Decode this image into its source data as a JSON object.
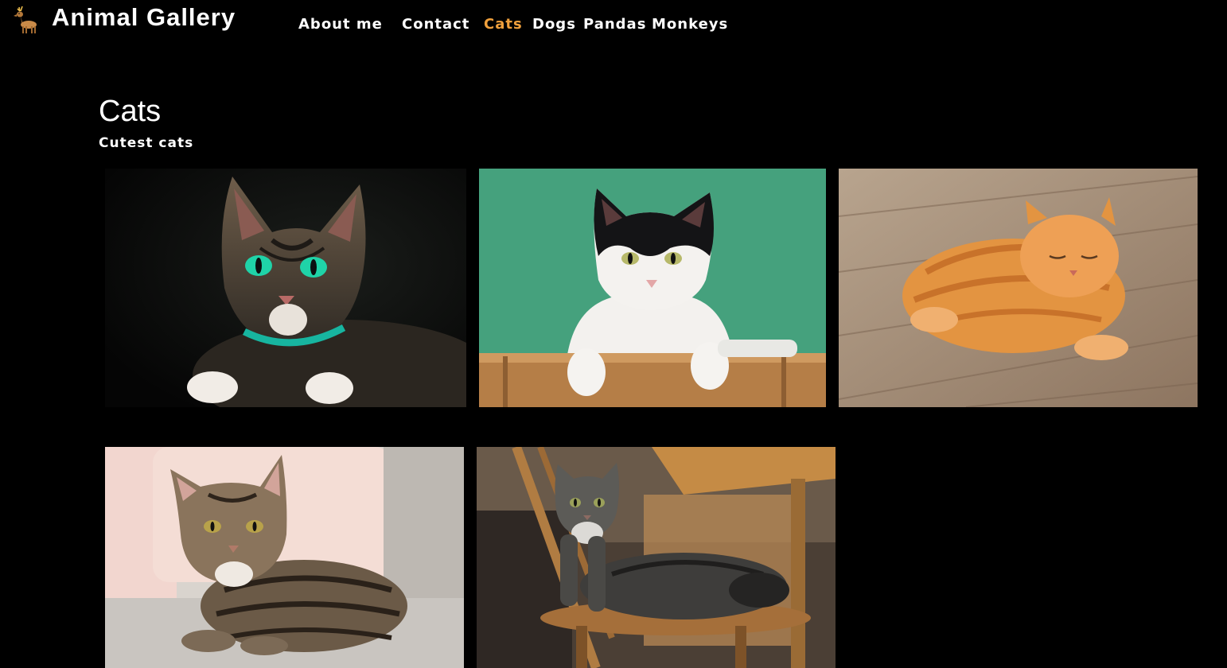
{
  "header": {
    "logo_icon": "deer-icon",
    "site_title": "Animal Gallery"
  },
  "nav": {
    "items": [
      {
        "label": "About me",
        "active": false
      },
      {
        "label": "Contact",
        "active": false
      },
      {
        "label": "Cats",
        "active": true
      },
      {
        "label": "Dogs",
        "active": false
      },
      {
        "label": "Pandas",
        "active": false
      },
      {
        "label": "Monkeys",
        "active": false
      }
    ],
    "active_color": "#f0a03c"
  },
  "main": {
    "title": "Cats",
    "subtitle": "Cutest cats"
  },
  "gallery": {
    "photos": [
      {
        "subject": "tabby cat with green eyes on dark background"
      },
      {
        "subject": "black and white cat on green background"
      },
      {
        "subject": "orange tabby cat sleeping on wooden floor"
      },
      {
        "subject": "tabby cat lying on light sofa"
      },
      {
        "subject": "grey longhair cat lying on wooden chair"
      }
    ]
  },
  "colors": {
    "background": "#000000",
    "text": "#ffffff",
    "accent": "#f0a03c"
  }
}
